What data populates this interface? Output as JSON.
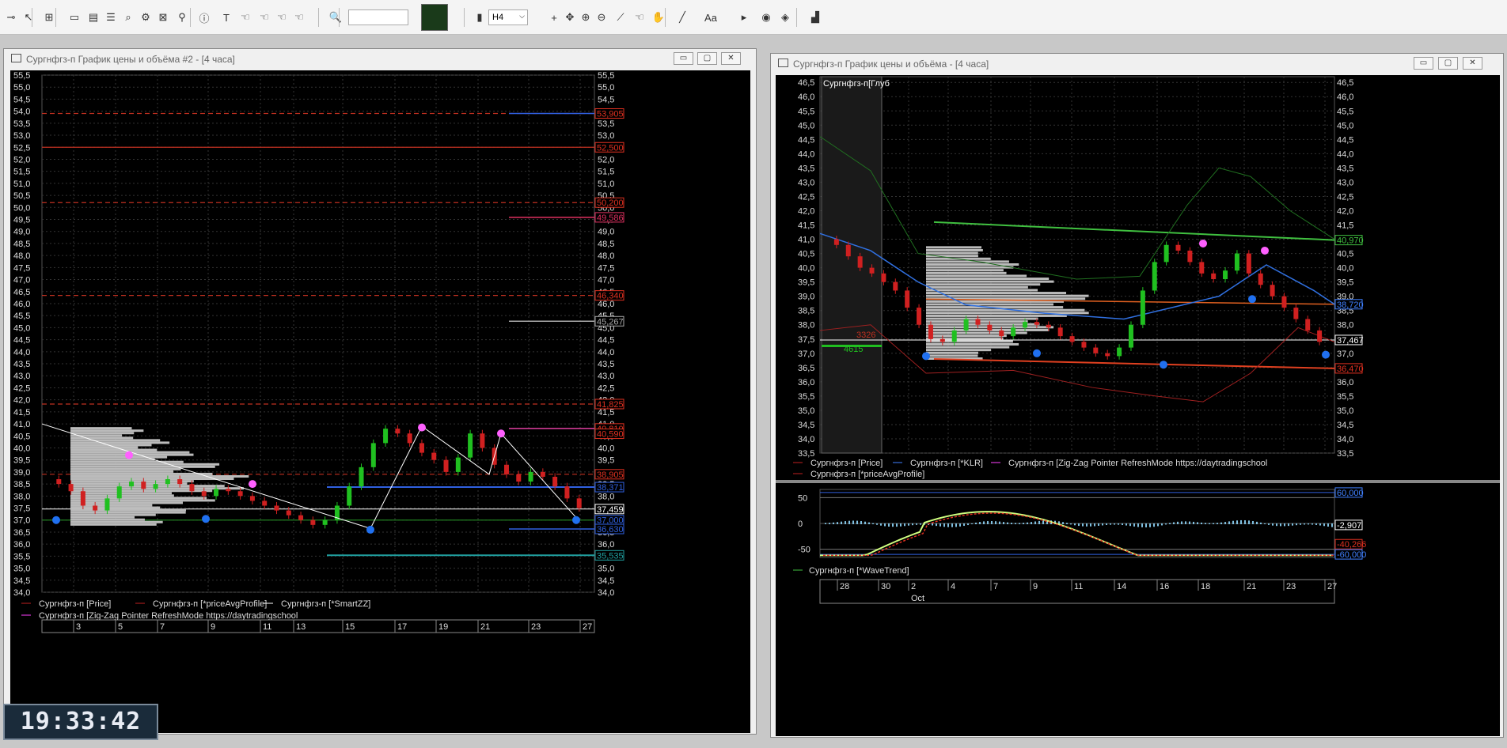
{
  "toolbar": {
    "timeframe": "H4",
    "icons": [
      "arrow-icon",
      "cursor-icon",
      "add-chart-icon",
      "window-icon",
      "chart-window-icon",
      "table-icon",
      "search-doc-icon",
      "settings-icon",
      "delete-icon",
      "pin-icon",
      "info-icon",
      "text-tool-icon",
      "hand-icon",
      "hand-icon",
      "hand-icon",
      "hand-icon",
      "magnifier-icon",
      "bar-chart-icon",
      "crosshair-icon",
      "move-icon",
      "zoom-in-icon",
      "zoom-out-icon",
      "ruler-icon",
      "hand-icon",
      "grab-icon",
      "line-icon",
      "font-icon",
      "pointer-icon",
      "eye-icon",
      "layers-icon",
      "indicator-icon"
    ]
  },
  "left_window": {
    "title": "Сургнфгз-п График цены и объёма #2 - [4 часа]",
    "price_labels": [
      "55,5",
      "55,0",
      "54,5",
      "54,0",
      "53,5",
      "53,0",
      "52,5",
      "52,0",
      "51,5",
      "51,0",
      "50,5",
      "50,0",
      "49,5",
      "49,0",
      "48,5",
      "48,0",
      "47,5",
      "47,0",
      "46,5",
      "46,0",
      "45,5",
      "45,0",
      "44,5",
      "44,0",
      "43,5",
      "43,0",
      "42,5",
      "42,0",
      "41,5",
      "41,0",
      "40,5",
      "40,0",
      "39,5",
      "39,0",
      "38,5",
      "38,0",
      "37,5",
      "37,0",
      "36,5",
      "36,0",
      "35,5",
      "35,0",
      "34,5",
      "34,0"
    ],
    "level_tags": [
      {
        "text": "53,905",
        "color": "#e03020",
        "price": 53.905
      },
      {
        "text": "52,500",
        "color": "#e03020",
        "price": 52.5
      },
      {
        "text": "50,200",
        "color": "#e03020",
        "price": 50.2
      },
      {
        "text": "49,586",
        "color": "#e03060",
        "price": 49.586
      },
      {
        "text": "46,340",
        "color": "#e03020",
        "price": 46.34
      },
      {
        "text": "45,267",
        "color": "#aaaaaa",
        "price": 45.267
      },
      {
        "text": "41,825",
        "color": "#e03020",
        "price": 41.825
      },
      {
        "text": "40,810",
        "color": "#e03020",
        "price": 40.81
      },
      {
        "text": "40,590",
        "color": "#e03020",
        "price": 40.59
      },
      {
        "text": "38,905",
        "color": "#e03020",
        "price": 38.905
      },
      {
        "text": "38,371",
        "color": "#3060e0",
        "price": 38.371
      },
      {
        "text": "37,459",
        "color": "#ffffff",
        "price": 37.459
      },
      {
        "text": "37,000",
        "color": "#3060e0",
        "price": 37.0
      },
      {
        "text": "36,630",
        "color": "#3060e0",
        "price": 36.63
      },
      {
        "text": "35,535",
        "color": "#20a0a0",
        "price": 35.535
      }
    ],
    "date_labels": [
      "3",
      "5",
      "7",
      "9",
      "11",
      "13",
      "15",
      "17",
      "19",
      "21",
      "23",
      "27"
    ],
    "legend": [
      {
        "text": "Сургнфгз-п [Price]",
        "color": "#c02020"
      },
      {
        "text": "Сургнфгз-п [*priceAvgProfile]",
        "color": "#c02020"
      },
      {
        "text": "Сургнфгз-п [*SmartZZ]",
        "color": "#ffffff"
      },
      {
        "text": "Сургнфгз-п [Zig-Zag Pointer RefreshMode https://daytradingschool",
        "color": "#ff40ff"
      }
    ]
  },
  "right_window": {
    "title": "Сургнфгз-п График цены и объёма - [4 часа]",
    "profile_label": "Сургнфгз-п[Глуб",
    "profile_values": [
      "3326",
      "4615"
    ],
    "price_labels": [
      "46,5",
      "46,0",
      "45,5",
      "45,0",
      "44,5",
      "44,0",
      "43,5",
      "43,0",
      "42,5",
      "42,0",
      "41,5",
      "41,0",
      "40,5",
      "40,0",
      "39,5",
      "39,0",
      "38,5",
      "38,0",
      "37,5",
      "37,0",
      "36,5",
      "36,0",
      "35,5",
      "35,0",
      "34,5",
      "34,0",
      "33,5"
    ],
    "level_tags": [
      {
        "text": "40,970",
        "color": "#40c040",
        "price": 40.97
      },
      {
        "text": "38,720",
        "color": "#4080ff",
        "price": 38.72
      },
      {
        "text": "37,467",
        "color": "#ffffff",
        "price": 37.467
      },
      {
        "text": "36,470",
        "color": "#e03020",
        "price": 36.47
      }
    ],
    "legend": [
      {
        "text": "Сургнфгз-п [Price]",
        "color": "#c02020"
      },
      {
        "text": "Сургнфгз-п [*KLR]",
        "color": "#4080ff"
      },
      {
        "text": "Сургнфгз-п [Zig-Zag Pointer RefreshMode https://daytradingschool",
        "color": "#ff40ff"
      },
      {
        "text": "Сургнфгз-п [*priceAvgProfile]",
        "color": "#c02020"
      }
    ],
    "osc_labels": [
      "50",
      "0",
      "-50"
    ],
    "osc_tags": [
      {
        "text": "60,000",
        "color": "#4080ff",
        "value": 60
      },
      {
        "text": "-2,907",
        "color": "#ffffff",
        "value": -2.907
      },
      {
        "text": "-40,266",
        "color": "#e03020",
        "value": -40.266
      },
      {
        "text": "-60,000",
        "color": "#4080ff",
        "value": -60
      }
    ],
    "osc_legend": {
      "text": "Сургнфгз-п [*WaveTrend]",
      "color": "#40c040"
    },
    "date_labels": [
      "28",
      "30",
      "2",
      "4",
      "7",
      "9",
      "11",
      "14",
      "16",
      "18",
      "21",
      "23",
      "27"
    ],
    "month_label": "Oct"
  },
  "clock": "19:33:42"
}
